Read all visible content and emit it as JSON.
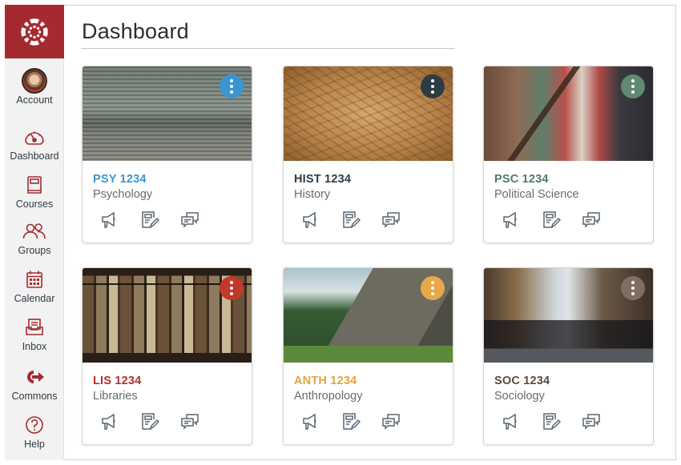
{
  "app": {
    "title": "Dashboard"
  },
  "sidebar": {
    "logo": "canvas-logo-icon",
    "items": [
      {
        "label": "Account",
        "icon": "avatar"
      },
      {
        "label": "Dashboard",
        "icon": "gauge-icon"
      },
      {
        "label": "Courses",
        "icon": "book-icon"
      },
      {
        "label": "Groups",
        "icon": "users-icon"
      },
      {
        "label": "Calendar",
        "icon": "calendar-icon"
      },
      {
        "label": "Inbox",
        "icon": "inbox-icon"
      },
      {
        "label": "Commons",
        "icon": "commons-icon"
      },
      {
        "label": "Help",
        "icon": "help-icon"
      }
    ],
    "accent": "#a52a2f"
  },
  "courses": [
    {
      "code": "PSY 1234",
      "name": "Psychology",
      "color": "#3b95d3",
      "menu_color": "#3b95d3",
      "image": "person walking past metal shutter"
    },
    {
      "code": "HIST 1234",
      "name": "History",
      "color": "#2d3b45",
      "menu_color": "#2d3b45",
      "image": "antique city map"
    },
    {
      "code": "PSC 1234",
      "name": "Political Science",
      "color": "#4f7a63",
      "menu_color": "#5f8a71",
      "image": "weathered flag and constitution"
    },
    {
      "code": "LIS 1234",
      "name": "Libraries",
      "color": "#b12f2f",
      "menu_color": "#c0392b",
      "image": "old books on shelf"
    },
    {
      "code": "ANTH 1234",
      "name": "Anthropology",
      "color": "#e8a33d",
      "menu_color": "#e8a84a",
      "image": "mayan pyramid temple"
    },
    {
      "code": "SOC 1234",
      "name": "Sociology",
      "color": "#5a4a3c",
      "menu_color": "#7d7062",
      "image": "crowded rainy street"
    }
  ],
  "card_actions": [
    {
      "icon": "announcements-icon"
    },
    {
      "icon": "assignments-icon"
    },
    {
      "icon": "discussions-icon"
    }
  ]
}
